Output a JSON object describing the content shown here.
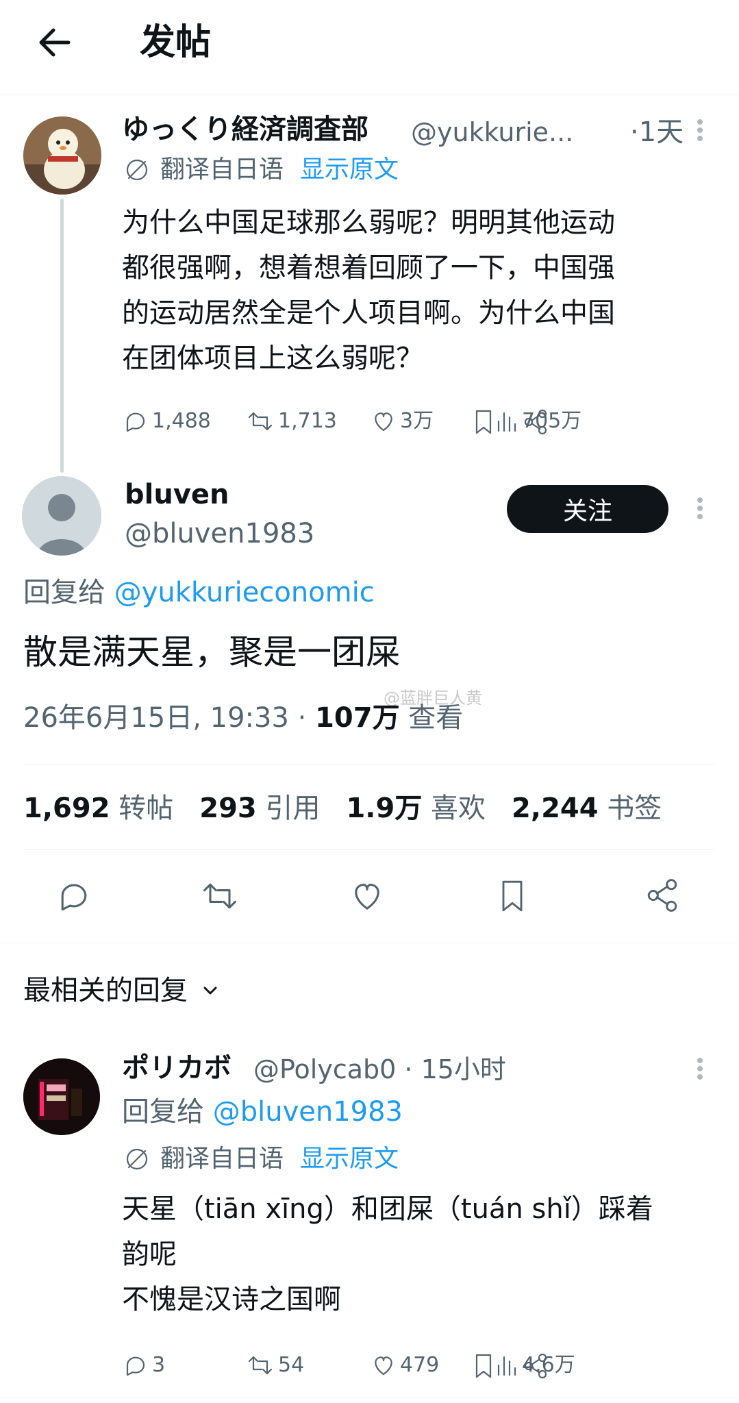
{
  "header": {
    "title": "发帖"
  },
  "original_tweet": {
    "display_name": "ゆっくり経済調査部",
    "handle": "@yukkurie...",
    "time": "·1天",
    "translate_label": "翻译自日语",
    "show_original": "显示原文",
    "lines": [
      "为什么中国足球那么弱呢？明明其他运动",
      "都很强啊，想着想着回顾了一下，中国强",
      "的运动居然全是个人项目啊。为什么中国",
      "在团体项目上这么弱呢？"
    ],
    "stats": {
      "replies": "1,488",
      "retweets": "1,713",
      "likes": "3万",
      "views": "705万"
    }
  },
  "main_tweet": {
    "display_name": "bluven",
    "handle": "@bluven1983",
    "follow_label": "关注",
    "reply_to_prefix": "回复给",
    "reply_to_handle": "@yukkurieconomic",
    "text": "散是满天星，聚是一团屎",
    "timestamp": "26年6月15日, 19:33 · ",
    "views_count": "107万",
    "views_label": " 查看",
    "watermark": "@蓝胖巨人黄",
    "stats": [
      {
        "value": "1,692",
        "label": "转帖"
      },
      {
        "value": "293",
        "label": "引用"
      },
      {
        "value": "1.9万",
        "label": "喜欢"
      },
      {
        "value": "2,244",
        "label": "书签"
      }
    ]
  },
  "replies_section": {
    "sort_label": "最相关的回复"
  },
  "reply_tweet": {
    "display_name": "ポリカボ",
    "handle": "@Polycab0 · 15小时",
    "reply_to_prefix": "回复给",
    "reply_to_handle": "@bluven1983",
    "translate_label": "翻译自日语",
    "show_original": "显示原文",
    "lines": [
      "天星（tiān xīng）和团屎（tuán shǐ）踩着",
      "韵呢",
      "不愧是汉诗之国啊"
    ],
    "stats": {
      "replies": "3",
      "retweets": "54",
      "likes": "479",
      "views": "4.6万"
    }
  },
  "colors": {
    "accent": "#1d9bf0",
    "muted": "#536471",
    "text": "#0f1419"
  }
}
